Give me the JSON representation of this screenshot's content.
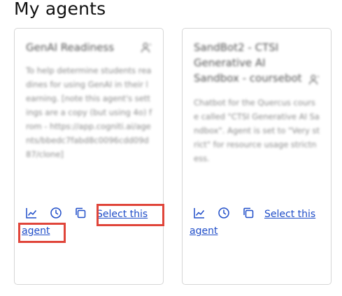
{
  "page": {
    "title": "My agents"
  },
  "cards": [
    {
      "title": "GenAI Readiness",
      "description": "To help determine students readines for using GenAI in their learning. [note this agent's settings are a copy (but using 4o) from - https://app.cogniti.ai/agents/bbedc7fabd8c0096cdd09d87/clone]",
      "select_line1": "Select this",
      "select_line2": "agent",
      "icons": [
        "user-icon",
        "analytics-icon",
        "history-icon",
        "copy-icon"
      ]
    },
    {
      "title": "SandBot2 - CTSI Generative AI Sandbox - coursebot",
      "description": "Chatbot for the Quercus course called \"CTSI Generative AI Sandbox\". Agent is set to \"Very strict\" for resource usage strictness.",
      "select_line1": "Select this",
      "select_line2": "agent",
      "icons": [
        "user-icon",
        "analytics-icon",
        "history-icon",
        "copy-icon"
      ]
    }
  ],
  "colors": {
    "link": "#1f4dc8",
    "highlight": "#e0453a",
    "border": "#d6d6d6"
  }
}
